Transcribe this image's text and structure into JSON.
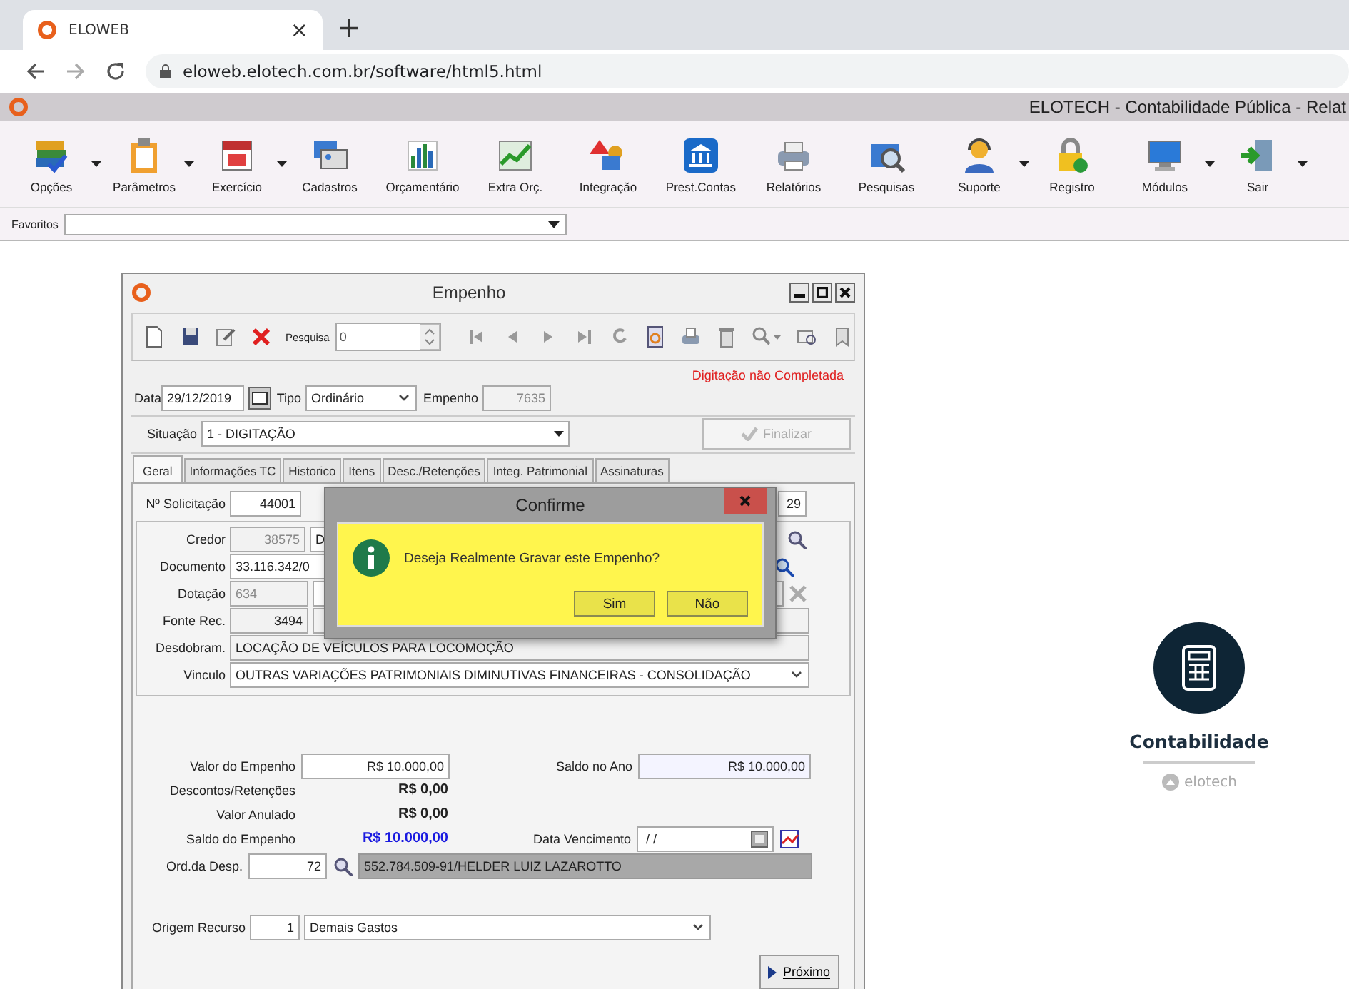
{
  "browser": {
    "tab": {
      "title": "ELOWEB",
      "close": "×"
    },
    "new_tab": "+",
    "address": "eloweb.elotech.com.br/software/html5.html"
  },
  "app": {
    "title": "ELOTECH - Contabilidade Pública - Relat",
    "toolbar": [
      {
        "label": "Opções",
        "menu": true
      },
      {
        "label": "Parâmetros",
        "menu": true
      },
      {
        "label": "Exercício",
        "menu": true
      },
      {
        "label": "Cadastros",
        "menu": false
      },
      {
        "label": "Orçamentário",
        "menu": false
      },
      {
        "label": "Extra Orç.",
        "menu": false
      },
      {
        "label": "Integração",
        "menu": false
      },
      {
        "label": "Prest.Contas",
        "menu": false
      },
      {
        "label": "Relatórios",
        "menu": false
      },
      {
        "label": "Pesquisas",
        "menu": false
      },
      {
        "label": "Suporte",
        "menu": true
      },
      {
        "label": "Registro",
        "menu": false
      },
      {
        "label": "Módulos",
        "menu": true
      },
      {
        "label": "Sair",
        "menu": true
      }
    ],
    "favorites_label": "Favoritos"
  },
  "empenho": {
    "title": "Empenho",
    "search_label": "Pesquisa",
    "search_value": "0",
    "warning": "Digitação não Completada",
    "date_label": "Data",
    "date": "29/12/2019",
    "type_label": "Tipo",
    "type": "Ordinário",
    "number_label": "Empenho",
    "number": "7635",
    "status_label": "Situação",
    "status": "1 - DIGITAÇÃO",
    "finalize": {
      "label": "Finalizar",
      "disabled": true
    },
    "tabs": [
      {
        "label": "Geral",
        "selected": true
      },
      {
        "label": "Informações TC",
        "selected": false
      },
      {
        "label": "Historico",
        "selected": false
      },
      {
        "label": "Itens",
        "selected": false
      },
      {
        "label": "Desc./Retenções",
        "selected": false
      },
      {
        "label": "Integ. Patrimonial",
        "selected": false
      },
      {
        "label": "Assinaturas",
        "selected": false
      }
    ],
    "solicitation": {
      "label": "Nº Solicitação",
      "value": "44001",
      "trailing": "29"
    },
    "creditor": {
      "label": "Credor",
      "code": "38575",
      "name": "D"
    },
    "document": {
      "label": "Documento",
      "value": "33.116.342/0"
    },
    "allocation": {
      "label": "Dotação",
      "code": "634"
    },
    "source": {
      "label": "Fonte Rec.",
      "code": "3494"
    },
    "breakdown": {
      "label": "Desdobram.",
      "value": "LOCAÇÃO DE VEÍCULOS PARA LOCOMOÇÃO"
    },
    "link": {
      "label": "Vinculo",
      "value": "OUTRAS VARIAÇÕES PATRIMONIAIS DIMINUTIVAS FINANCEIRAS - CONSOLIDAÇÃO"
    },
    "amount": {
      "label": "Valor do Empenho",
      "value": "R$ 10.000,00"
    },
    "year_balance": {
      "label": "Saldo no Ano",
      "value": "R$ 10.000,00"
    },
    "discounts": {
      "label": "Descontos/Retenções",
      "value": "R$ 0,00"
    },
    "cancelled": {
      "label": "Valor Anulado",
      "value": "R$ 0,00"
    },
    "balance": {
      "label": "Saldo do Empenho",
      "value": "R$ 10.000,00"
    },
    "due_date": {
      "label": "Data Vencimento",
      "value": " / /"
    },
    "order": {
      "label": "Ord.da Desp.",
      "code": "72",
      "name": "552.784.509-91/HELDER LUIZ LAZAROTTO"
    },
    "origin": {
      "label": "Origem Recurso",
      "code": "1",
      "value": "Demais Gastos"
    },
    "next_button": "Próximo"
  },
  "confirm": {
    "title": "Confirme",
    "message": "Deseja Realmente Gravar este Empenho?",
    "buttons": [
      "Sim",
      "Não"
    ]
  },
  "brand": {
    "title": "Contabilidade",
    "company": "elotech"
  }
}
